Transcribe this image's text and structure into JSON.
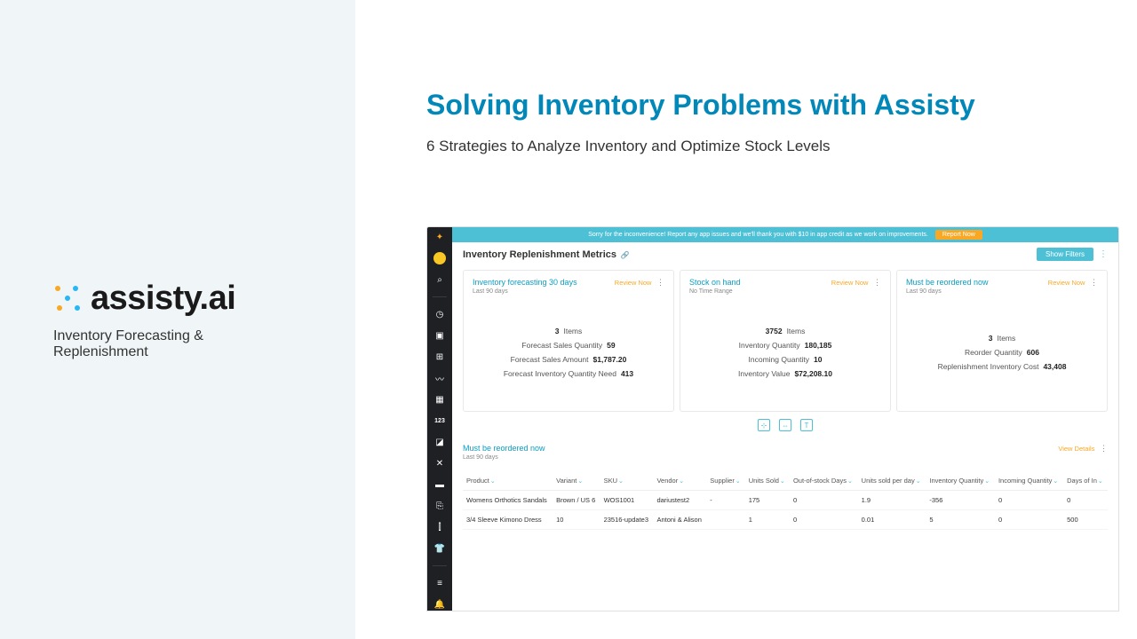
{
  "left": {
    "brand": "assisty.ai",
    "tagline": "Inventory Forecasting & Replenishment"
  },
  "headline": "Solving Inventory Problems with Assisty",
  "subhead": "6 Strategies to Analyze Inventory and Optimize Stock Levels",
  "app": {
    "banner": {
      "text": "Sorry for the inconvenience! Report any app issues and we'll thank you with $10 in app credit as we work on improvements.",
      "button": "Report Now"
    },
    "pageTitle": "Inventory Replenishment Metrics",
    "showFilters": "Show Filters",
    "cards": [
      {
        "title": "Inventory forecasting 30 days",
        "sub": "Last 90 days",
        "action": "Review Now",
        "stats": [
          {
            "label": "Items",
            "value": "3",
            "inline": true
          },
          {
            "label": "Forecast Sales Quantity",
            "value": "59"
          },
          {
            "label": "Forecast Sales Amount",
            "value": "$1,787.20"
          },
          {
            "label": "Forecast Inventory Quantity Need",
            "value": "413"
          }
        ]
      },
      {
        "title": "Stock on hand",
        "sub": "No Time Range",
        "action": "Review Now",
        "stats": [
          {
            "label": "Items",
            "value": "3752",
            "inline": true
          },
          {
            "label": "Inventory Quantity",
            "value": "180,185"
          },
          {
            "label": "Incoming Quantity",
            "value": "10"
          },
          {
            "label": "Inventory Value",
            "value": "$72,208.10"
          }
        ]
      },
      {
        "title": "Must be reordered now",
        "sub": "Last 90 days",
        "action": "Review Now",
        "stats": [
          {
            "label": "Items",
            "value": "3",
            "inline": true
          },
          {
            "label": "Reorder Quantity",
            "value": "606"
          },
          {
            "label": "Replenishment Inventory Cost",
            "value": "43,408"
          }
        ]
      }
    ],
    "table": {
      "title": "Must be reordered now",
      "sub": "Last 90 days",
      "viewDetails": "View Details",
      "columns": [
        "Product",
        "Variant",
        "SKU",
        "Vendor",
        "Supplier",
        "Units Sold",
        "Out-of-stock Days",
        "Units sold per day",
        "Inventory Quantity",
        "Incoming Quantity",
        "Days of In"
      ],
      "rows": [
        [
          "Womens Orthotics Sandals",
          "Brown / US 6",
          "WOS1001",
          "dariustest2",
          "-",
          "175",
          "0",
          "1.9",
          "-356",
          "0",
          "0"
        ],
        [
          "3/4 Sleeve Kimono Dress",
          "10",
          "23516-update3",
          "Antoni & Alison",
          "",
          "1",
          "0",
          "0.01",
          "5",
          "0",
          "500"
        ]
      ]
    }
  }
}
